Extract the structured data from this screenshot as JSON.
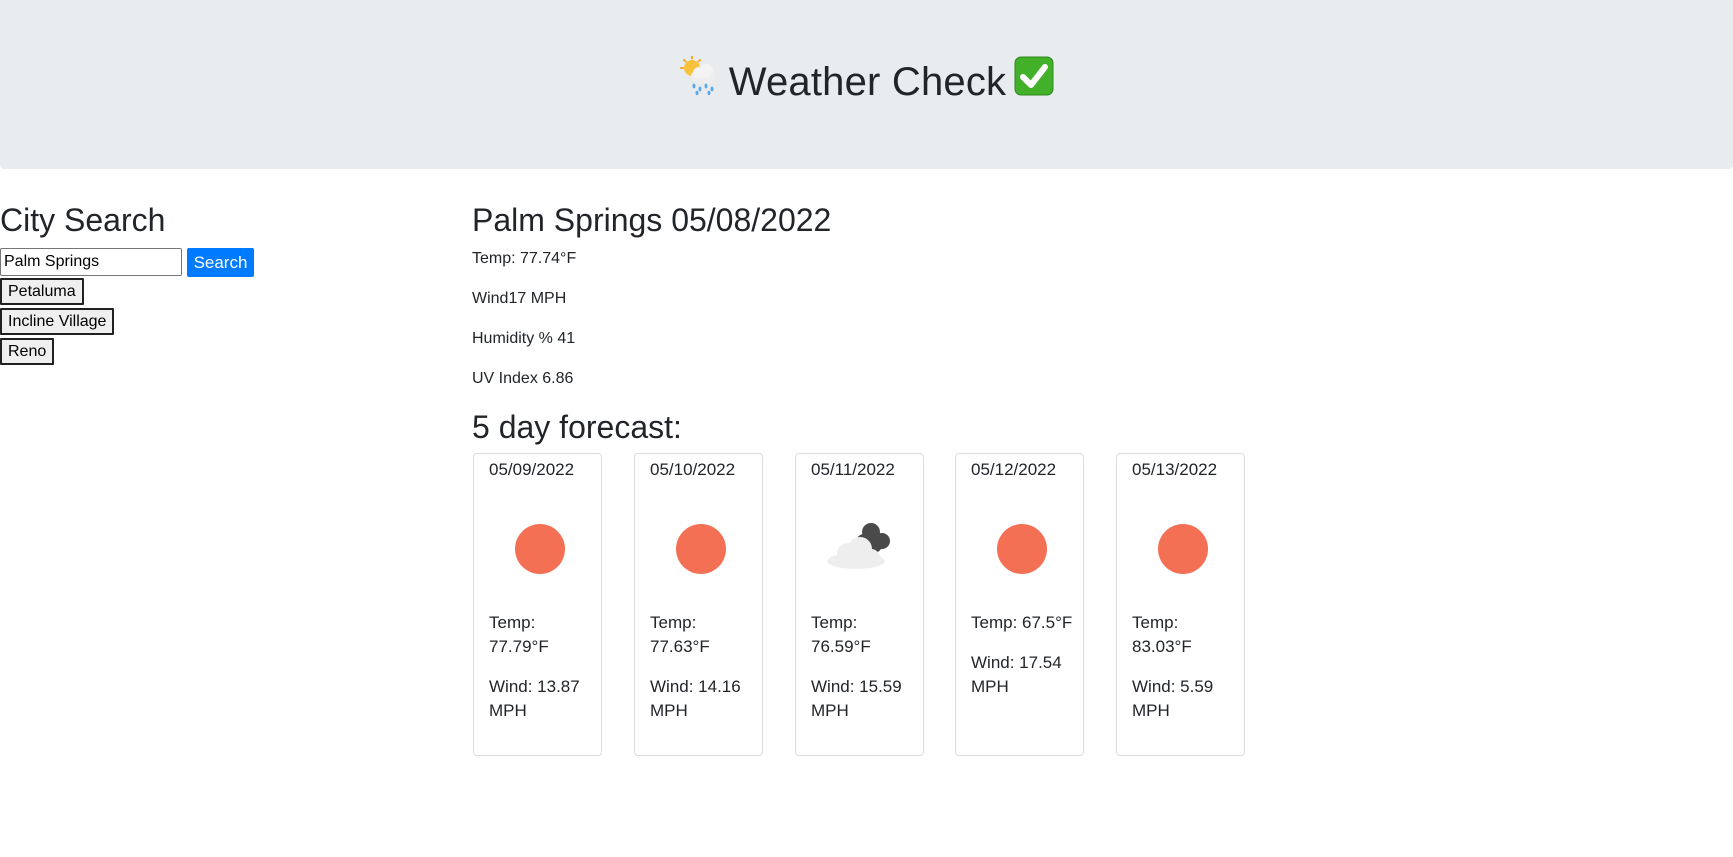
{
  "header": {
    "title": "Weather Check",
    "emoji_left": "🌦️",
    "emoji_right": "✅"
  },
  "search": {
    "heading": "City Search",
    "input_value": "Palm Springs",
    "button_label": "Search",
    "history": [
      "Petaluma",
      "Incline Village",
      "Reno"
    ]
  },
  "current": {
    "title": "Palm Springs 05/08/2022",
    "temp": "Temp: 77.74°F",
    "wind": "Wind17 MPH",
    "humidity": "Humidity % 41",
    "uv": "UV Index 6.86"
  },
  "forecast": {
    "heading": "5 day forecast:",
    "days": [
      {
        "date": "05/09/2022",
        "icon": "sun-icon",
        "temp": "Temp: 77.79°F",
        "wind": "Wind: 13.87 MPH"
      },
      {
        "date": "05/10/2022",
        "icon": "sun-icon",
        "temp": "Temp: 77.63°F",
        "wind": "Wind: 14.16 MPH"
      },
      {
        "date": "05/11/2022",
        "icon": "clouds-icon",
        "temp": "Temp: 76.59°F",
        "wind": "Wind: 15.59 MPH"
      },
      {
        "date": "05/12/2022",
        "icon": "sun-icon",
        "temp": "Temp: 67.5°F",
        "wind": "Wind: 17.54 MPH"
      },
      {
        "date": "05/13/2022",
        "icon": "sun-icon",
        "temp": "Temp: 83.03°F",
        "wind": "Wind: 5.59 MPH"
      }
    ]
  },
  "colors": {
    "header_bg": "#e9ecef",
    "accent": "#007bff",
    "sun": "#f47055"
  }
}
